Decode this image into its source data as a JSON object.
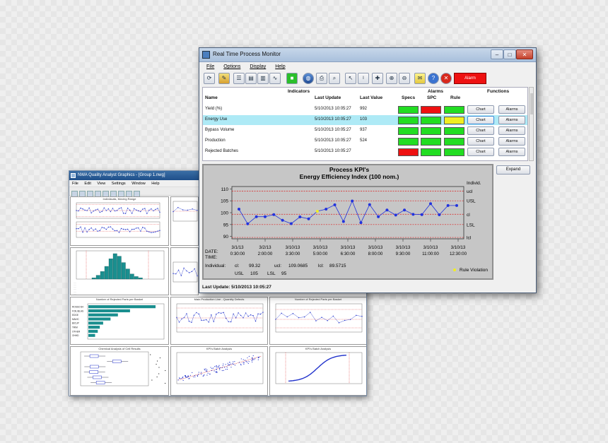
{
  "back_window": {
    "title": "NWA Quality Analyst Graphics - [Group 1.nwg]",
    "menu": [
      "File",
      "Edit",
      "View",
      "Settings",
      "Window",
      "Help"
    ],
    "charts": [
      {
        "title": "Individuals, Moving Range"
      },
      {
        "title": ""
      },
      {
        "title": "Histogram"
      },
      {
        "title": ""
      },
      {
        "title": "Number of Rejected Parts per Basket"
      },
      {
        "title": "Main Production Line - Quantity Defects"
      },
      {
        "title": "Number of Rejected Parts per Basket"
      },
      {
        "title": "Chemical Analysis of Cell Results"
      },
      {
        "title": "KPI's Batch Analysis"
      },
      {
        "title": "KPI's Batch Analysis"
      }
    ],
    "pareto_labels": [
      "ROSSO 84",
      "FOIL/BLAS",
      "EDGE",
      "MAVIC",
      "BICUP",
      "TRIM",
      "OTHER",
      "OHHD"
    ],
    "pareto_values": [
      100,
      62,
      44,
      33,
      22,
      17,
      14,
      10
    ],
    "histogram_values": [
      1,
      3,
      6,
      10,
      16,
      20,
      18,
      13,
      8,
      4,
      2,
      1
    ]
  },
  "main_window": {
    "title": "Real Time Process Monitor",
    "menu": {
      "file": "File",
      "options": "Options",
      "display": "Display",
      "help": "Help"
    },
    "toolbar": {
      "alarm_label": "Alarm",
      "alarm_color": "#ee1111"
    },
    "table": {
      "headers": {
        "indicators": "Indicators",
        "alarms": "Alarms",
        "functions": "Functions",
        "name": "Name",
        "last_update": "Last Update",
        "last_value": "Last Value",
        "specs": "Specs",
        "spc": "SPC",
        "rule": "Rule"
      },
      "rows": [
        {
          "name": "Yield (%)",
          "update": "5/10/2013 10:05:27",
          "value": "992",
          "specs": "#22dd22",
          "spc": "#ee1111",
          "rule": "#22dd22"
        },
        {
          "name": "Energy Use",
          "update": "5/10/2013 10:05:27",
          "value": "103",
          "specs": "#22dd22",
          "spc": "#22dd22",
          "rule": "#f0ee22"
        },
        {
          "name": "Bypass Volume",
          "update": "5/10/2013 10:05:27",
          "value": "937",
          "specs": "#22dd22",
          "spc": "#22dd22",
          "rule": "#22dd22"
        },
        {
          "name": "Production",
          "update": "5/10/2013 10:05:27",
          "value": "524",
          "specs": "#22dd22",
          "spc": "#22dd22",
          "rule": "#22dd22"
        },
        {
          "name": "Rejected Batches",
          "update": "5/10/2013 10:05:27",
          "value": "",
          "specs": "#ee1111",
          "spc": "#22dd22",
          "rule": "#22dd22"
        }
      ],
      "chart_label": "Chart",
      "alarms_label": "Alarms",
      "selected_row": 1
    },
    "expand_label": "Expand",
    "status": "Last Update: 5/10/2013 10:05:27"
  },
  "chart_data": {
    "type": "line",
    "title": "Process KPI's",
    "subtitle": "Energy Efficiency Index (100 nom.)",
    "xlabel": "",
    "ylabel": "",
    "ylim": [
      89,
      111
    ],
    "yticks": [
      90,
      95,
      100,
      105,
      110
    ],
    "limit_labels": {
      "individ": "Individ.",
      "ucl": "ucl",
      "usl": "USL",
      "cl": "cl",
      "lsl": "LSL",
      "lcl": "lcl"
    },
    "limits": {
      "ucl": 109.0685,
      "usl": 105,
      "cl": 99.32,
      "lsl": 95,
      "lcl": 89.5715
    },
    "x": [
      1,
      2,
      3,
      4,
      5,
      6,
      7,
      8,
      9,
      10,
      11,
      12,
      13,
      14,
      15,
      16,
      17,
      18,
      19,
      20,
      21,
      22,
      23,
      24,
      25,
      26
    ],
    "values": [
      101.5,
      95.3,
      98.3,
      98.3,
      99.2,
      96.8,
      95.4,
      98.2,
      97.4,
      100.6,
      101.5,
      103.3,
      96.3,
      104.9,
      95.8,
      103.4,
      98.3,
      101.1,
      99.0,
      101.1,
      99.3,
      99.2,
      103.8,
      99.1,
      103.0,
      103.0
    ],
    "violations": [
      9
    ],
    "x_ticks": [
      {
        "date": "3/1/13",
        "time": "0:30:00"
      },
      {
        "date": "3/2/13",
        "time": "2:00:00"
      },
      {
        "date": "3/10/13",
        "time": "3:30:00"
      },
      {
        "date": "3/10/13",
        "time": "5:00:00"
      },
      {
        "date": "3/10/13",
        "time": "6:30:00"
      },
      {
        "date": "3/10/13",
        "time": "8:00:00"
      },
      {
        "date": "3/10/13",
        "time": "9:30:00"
      },
      {
        "date": "3/10/13",
        "time": "11:00:00"
      },
      {
        "date": "3/10/13",
        "time": "12:30:00"
      }
    ],
    "date_label": "DATE:",
    "time_label": "TIME:",
    "stats": {
      "individual_label": "Individual:",
      "cl_label": "cl:",
      "cl": "99.32",
      "ucl_label": "ucl:",
      "ucl": "109.0685",
      "lcl_label": "lcl:",
      "lcl": "89.5715",
      "usl_label": "USL",
      "usl": "105",
      "lsl_label": "LSL",
      "lsl": "95"
    },
    "legend": "Rule Violation",
    "colors": {
      "line": "#2233dd",
      "limits": "#dd2222",
      "violation": "#f0ee22"
    }
  }
}
